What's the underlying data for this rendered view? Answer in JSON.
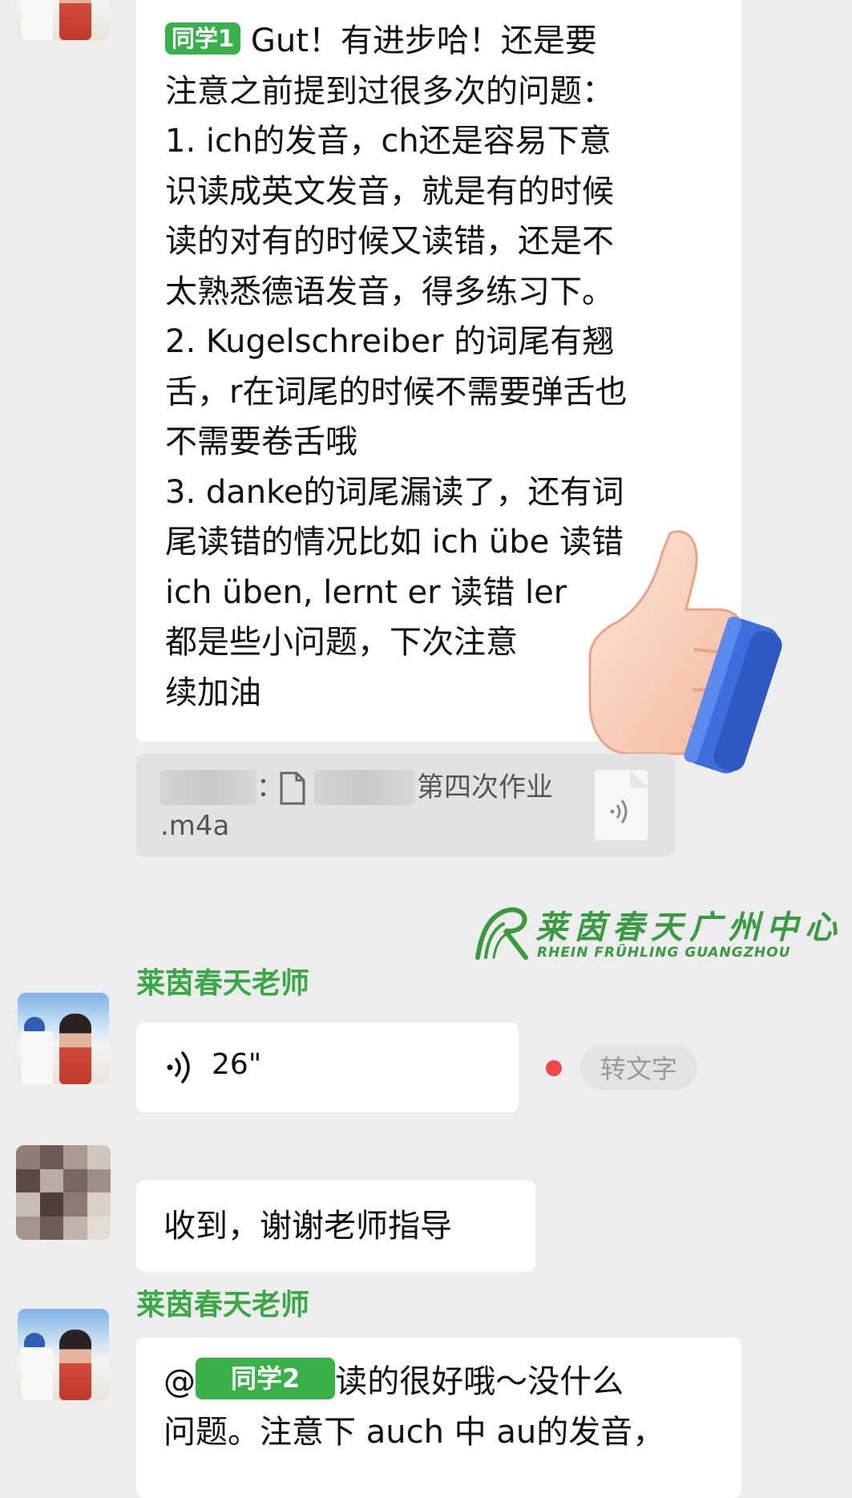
{
  "chat": {
    "message1": {
      "mention": "同学1",
      "text": "Gut！有进步哈！还是要\n注意之前提到过很多次的问题：\n1. ich的发音，ch还是容易下意\n识读成英文发音，就是有的时候\n读的对有的时候又读错，还是不\n太熟悉德语发音，得多练习下。\n2. Kugelschreiber 的词尾有翘\n舌，r在词尾的时候不需要弹舌也\n不需要卷舌哦\n3. danke的词尾漏读了，还有词\n尾读错的情况比如 ich übe 读错\nich üben, lernt er 读错 ler\n都是些小问题，下次注意\n续加油",
      "icon": "thumbs-up-sticker"
    },
    "file_quote": {
      "separator": "：",
      "name": "第四次作业",
      "ext": ".m4a",
      "icon": "audio-file-icon"
    },
    "watermark": {
      "cn": "莱茵春天广州中心",
      "en": "RHEIN FRÜHLING GUANGZHOU"
    },
    "message2": {
      "sender": "莱茵春天老师",
      "duration": "26\"",
      "transcribe_label": "转文字",
      "unread_color": "#f04848"
    },
    "message3": {
      "text": "收到，谢谢老师指导"
    },
    "message4": {
      "sender": "莱茵春天老师",
      "mention": "同学2",
      "text_line1": "读的很好哦～没什么",
      "text_line2": "问题。注意下 auch 中 au的发音，"
    }
  },
  "colors": {
    "background": "#ededed",
    "bubble": "#ffffff",
    "sender_green": "#3aa845",
    "mention_green": "#38b14a"
  }
}
